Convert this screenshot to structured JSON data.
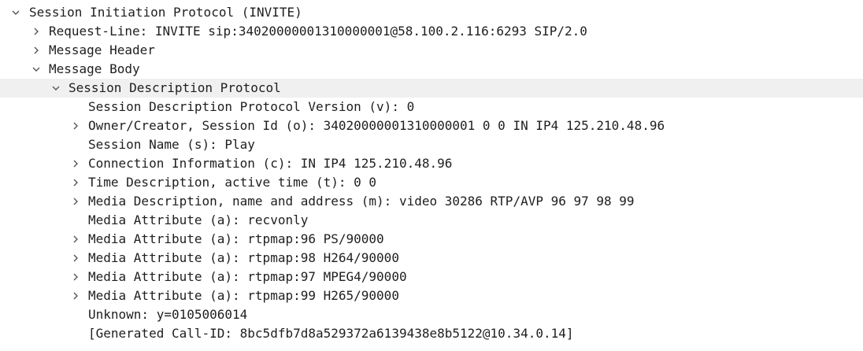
{
  "tree": {
    "root_label": "Session Initiation Protocol (INVITE)",
    "request_line": "Request-Line: INVITE sip:34020000001310000001@58.100.2.116:6293 SIP/2.0",
    "message_header": "Message Header",
    "message_body": "Message Body",
    "sdp_label": "Session Description Protocol",
    "sdp_fields": [
      "Session Description Protocol Version (v): 0",
      "Owner/Creator, Session Id (o): 34020000001310000001 0 0 IN IP4 125.210.48.96",
      "Session Name (s): Play",
      "Connection Information (c): IN IP4 125.210.48.96",
      "Time Description, active time (t): 0 0",
      "Media Description, name and address (m): video 30286 RTP/AVP 96 97 98 99",
      "Media Attribute (a): recvonly",
      "Media Attribute (a): rtpmap:96 PS/90000",
      "Media Attribute (a): rtpmap:98 H264/90000",
      "Media Attribute (a): rtpmap:97 MPEG4/90000",
      "Media Attribute (a): rtpmap:99 H265/90000",
      "Unknown: y=0105006014",
      "[Generated Call-ID: 8bc5dfb7d8a529372a6139438e8b5122@10.34.0.14]"
    ]
  },
  "colors": {
    "text": "#1e1e1e",
    "chevron": "#555555",
    "selected_row": "#f0f0f0"
  },
  "icons": {
    "expanded": "chevron-down-icon",
    "collapsed": "chevron-right-icon"
  }
}
